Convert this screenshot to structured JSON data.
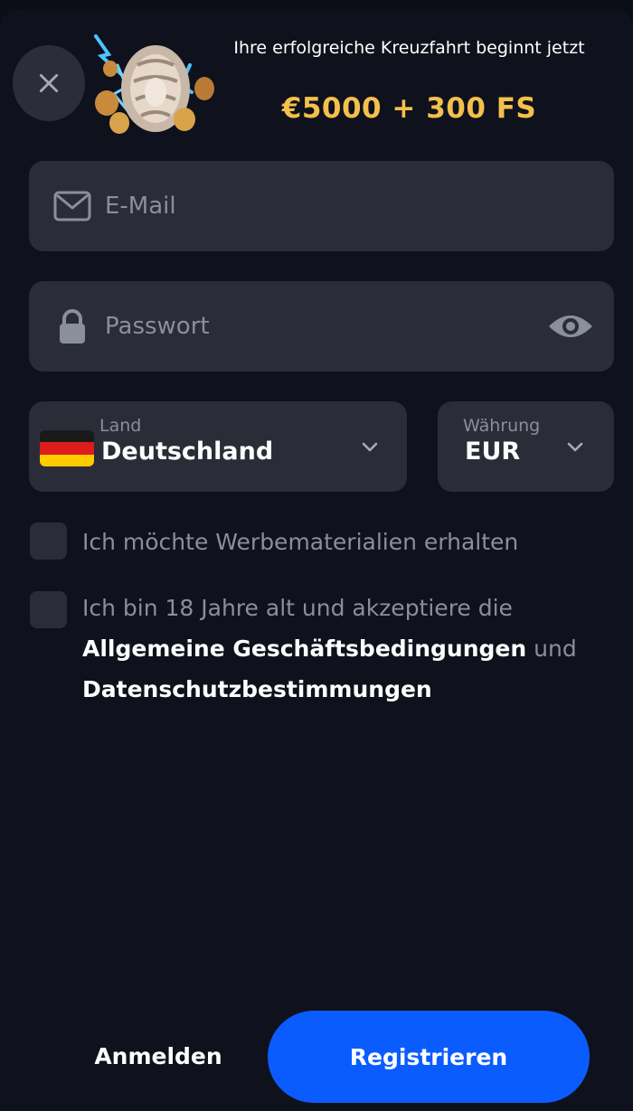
{
  "header": {
    "close_icon": "close-icon",
    "promo_image": "seashell-coins-icon",
    "promo_title": "Ihre erfolgreiche Kreuzfahrt beginnt jetzt",
    "promo_amount": "€5000 + 300 FS",
    "promo_color": "#f3c04b"
  },
  "form": {
    "email": {
      "placeholder": "E-Mail",
      "value": "",
      "icon": "mail-icon"
    },
    "password": {
      "placeholder": "Passwort",
      "value": "",
      "icon": "lock-icon",
      "toggle_icon": "eye-icon"
    },
    "country": {
      "label": "Land",
      "value": "Deutschland",
      "flag": "germany-flag-icon"
    },
    "currency": {
      "label": "Währung",
      "value": "EUR"
    },
    "promo_checkbox": {
      "checked": false,
      "label": "Ich möchte Werbematerialien erhalten"
    },
    "terms_checkbox": {
      "checked": false,
      "text_before": "Ich bin 18 Jahre alt und akzeptiere die ",
      "terms_link": "Allgemeine Geschäftsbedingungen",
      "text_middle": " und ",
      "privacy_link": "Datenschutzbestimmungen"
    }
  },
  "footer": {
    "login_label": "Anmelden",
    "register_label": "Registrieren",
    "accent_color": "#0a5cff"
  }
}
